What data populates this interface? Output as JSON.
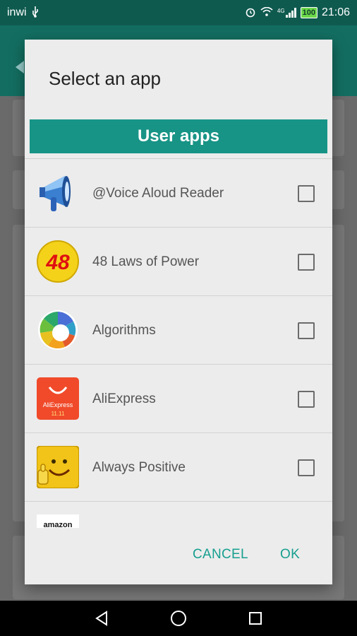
{
  "status_bar": {
    "carrier": "inwi",
    "usb_icon": "usb-icon",
    "alarm_icon": "alarm-icon",
    "wifi_icon": "wifi-icon",
    "network": "4G",
    "battery": "100",
    "time": "21:06"
  },
  "dialog": {
    "title": "Select an app",
    "section_header": "User apps",
    "apps": [
      {
        "name": "@Voice Aloud Reader",
        "icon": "megaphone-icon",
        "checked": false
      },
      {
        "name": "48 Laws of Power",
        "icon": "48-laws-icon",
        "checked": false
      },
      {
        "name": "Algorithms",
        "icon": "algorithms-icon",
        "checked": false
      },
      {
        "name": "AliExpress",
        "icon": "aliexpress-icon",
        "checked": false
      },
      {
        "name": "Always Positive",
        "icon": "smiley-icon",
        "checked": false
      },
      {
        "name": "",
        "icon": "amazon-icon",
        "checked": false
      }
    ],
    "icon_text": {
      "laws": "48",
      "aliexpress": "AliExpress",
      "aliexpress_sale": "11.11",
      "amazon": "amazon"
    },
    "cancel_label": "CANCEL",
    "ok_label": "OK"
  },
  "colors": {
    "accent": "#179486",
    "status_bar": "#0f5a4f"
  },
  "nav_bar": {
    "back_icon": "back-triangle-icon",
    "home_icon": "home-circle-icon",
    "recents_icon": "recents-square-icon"
  }
}
